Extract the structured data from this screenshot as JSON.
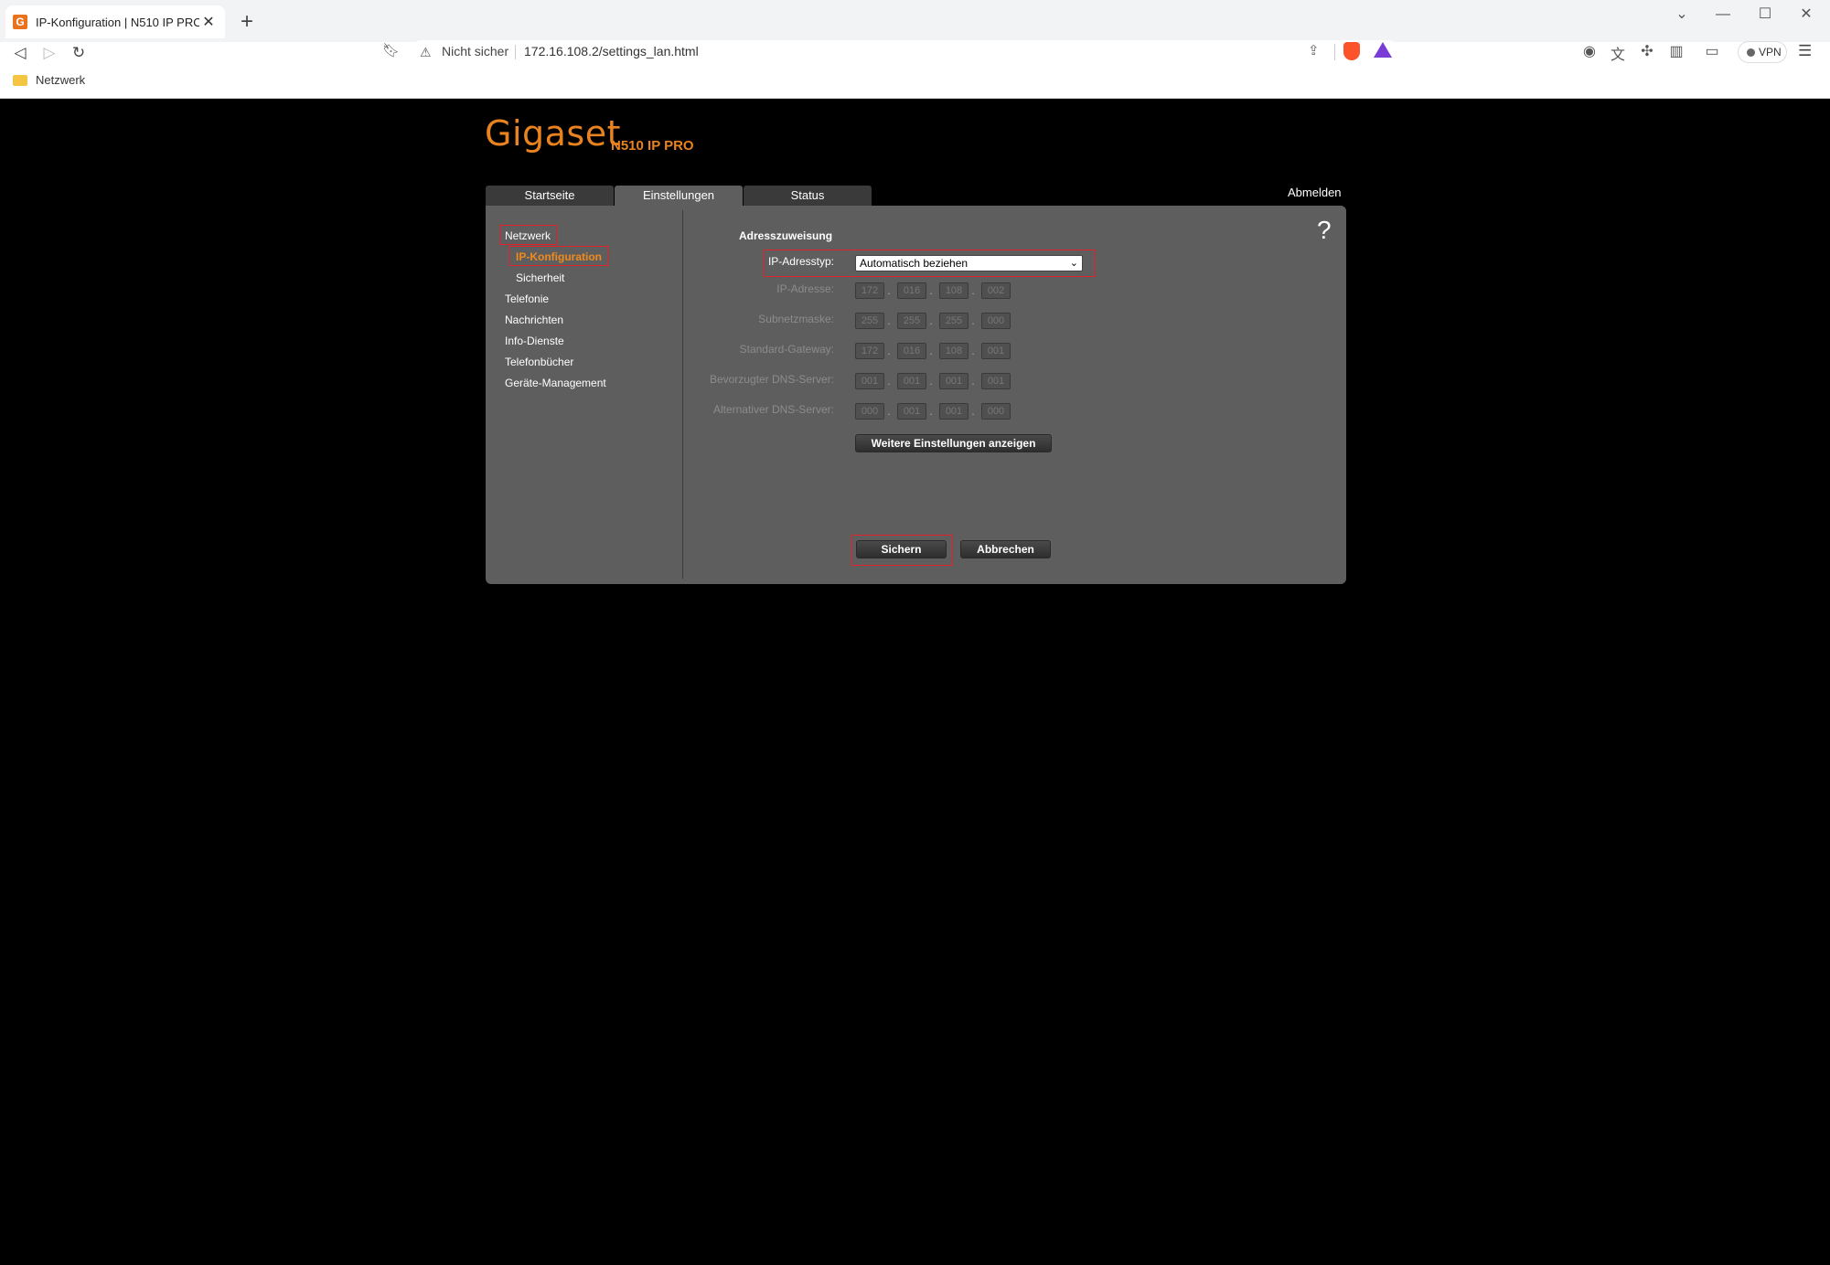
{
  "browser": {
    "tab_title": "IP-Konfiguration | N510 IP PRO",
    "favicon_letter": "G",
    "security_label": "Nicht sicher",
    "url": "172.16.108.2/settings_lan.html",
    "vpn_label": "VPN",
    "bookmark_folder": "Netzwerk",
    "accent_color": "#fb542b"
  },
  "header": {
    "brand": "Gigaset",
    "model": "N510 IP PRO",
    "brand_color": "#e8831f",
    "logout": "Abmelden"
  },
  "tabs": [
    {
      "label": "Startseite"
    },
    {
      "label": "Einstellungen"
    },
    {
      "label": "Status"
    }
  ],
  "sidebar": {
    "items": [
      {
        "label": "Netzwerk"
      },
      {
        "label": "IP-Konfiguration"
      },
      {
        "label": "Sicherheit"
      },
      {
        "label": "Telefonie"
      },
      {
        "label": "Nachrichten"
      },
      {
        "label": "Info-Dienste"
      },
      {
        "label": "Telefonbücher"
      },
      {
        "label": "Geräte-Management"
      }
    ],
    "active_color": "#f08a1d"
  },
  "help_symbol": "?",
  "form": {
    "section_title": "Adresszuweisung",
    "ip_type_label": "IP-Adresstyp:",
    "ip_type_value": "Automatisch beziehen",
    "fields": [
      {
        "label": "IP-Adresse:",
        "octets": [
          "172",
          "016",
          "108",
          "002"
        ]
      },
      {
        "label": "Subnetzmaske:",
        "octets": [
          "255",
          "255",
          "255",
          "000"
        ]
      },
      {
        "label": "Standard-Gateway:",
        "octets": [
          "172",
          "016",
          "108",
          "001"
        ]
      },
      {
        "label": "Bevorzugter DNS-Server:",
        "octets": [
          "001",
          "001",
          "001",
          "001"
        ]
      },
      {
        "label": "Alternativer DNS-Server:",
        "octets": [
          "000",
          "001",
          "001",
          "000"
        ]
      }
    ],
    "more_settings_button": "Weitere Einstellungen anzeigen",
    "save_button": "Sichern",
    "cancel_button": "Abbrechen"
  }
}
